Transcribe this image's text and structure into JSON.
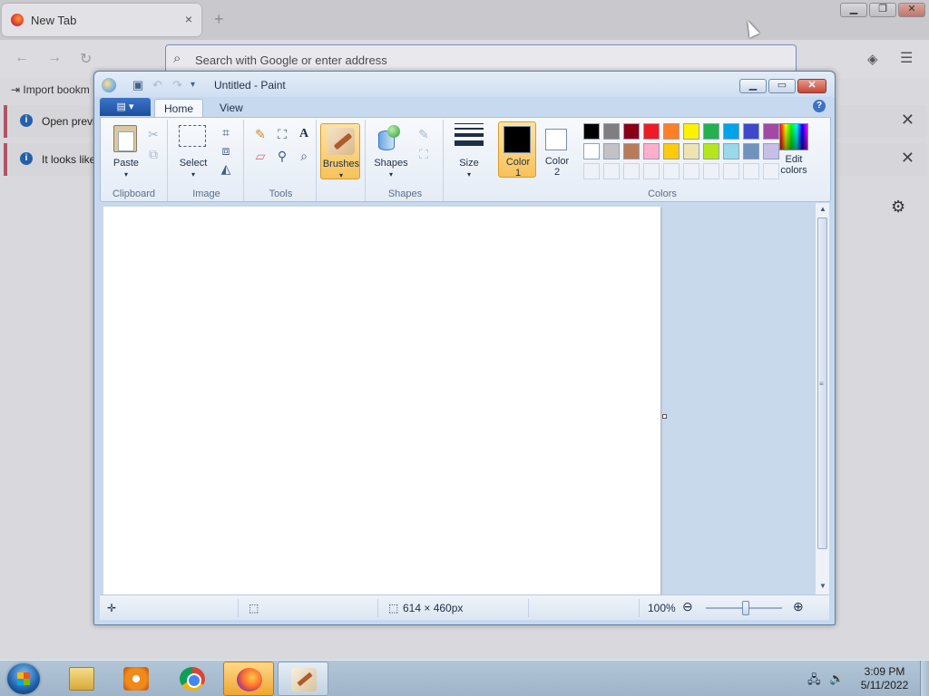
{
  "browser": {
    "tab_title": "New Tab",
    "tab_close": "×",
    "new_tab": "+",
    "search_placeholder": "Search with Google or enter address",
    "import_bookmarks": "Import bookm",
    "info_bars": [
      {
        "text": "Open previ"
      },
      {
        "text": "It looks like"
      }
    ]
  },
  "paint": {
    "title": "Untitled - Paint",
    "tabs": [
      {
        "label": "Home",
        "active": true
      },
      {
        "label": "View",
        "active": false
      }
    ],
    "groups": {
      "clipboard": {
        "label": "Clipboard",
        "paste_label": "Paste"
      },
      "image": {
        "label": "Image",
        "select_label": "Select"
      },
      "tools": {
        "label": "Tools"
      },
      "brushes_label": "Brushes",
      "shapes": {
        "label": "Shapes",
        "shapes_label": "Shapes"
      },
      "size_label": "Size",
      "colors": {
        "label": "Colors",
        "color1_label": "Color",
        "color1_num": "1",
        "color2_label": "Color",
        "color2_num": "2",
        "edit_label_1": "Edit",
        "edit_label_2": "colors",
        "color1": "#000000",
        "color2": "#ffffff",
        "palette_row1": [
          "#000000",
          "#7f7f7f",
          "#880015",
          "#ed1c24",
          "#ff7f27",
          "#fff200",
          "#22b14c",
          "#00a2e8",
          "#3f48cc",
          "#a349a4"
        ],
        "palette_row2": [
          "#ffffff",
          "#c3c3c3",
          "#b97a57",
          "#ffaec9",
          "#ffc90e",
          "#efe4b0",
          "#b5e61d",
          "#99d9ea",
          "#7092be",
          "#c8bfe7"
        ]
      }
    },
    "status": {
      "dimensions": "614 × 460px",
      "zoom": "100%"
    }
  },
  "taskbar": {
    "time": "3:09 PM",
    "date": "5/11/2022"
  }
}
